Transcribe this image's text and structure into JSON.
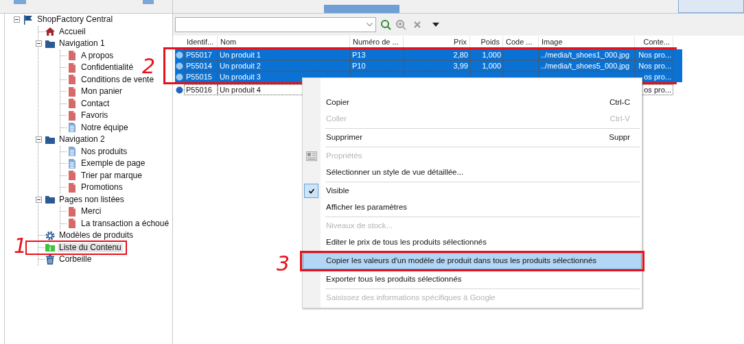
{
  "tree": [
    {
      "label": "ShopFactory Central",
      "kind": "flag",
      "expanded": true,
      "selected": false,
      "children": [
        {
          "label": "Accueil",
          "kind": "house",
          "selected": false
        },
        {
          "label": "Navigation 1",
          "kind": "folder",
          "expanded": true,
          "selected": false,
          "children": [
            {
              "label": "A propos",
              "kind": "page",
              "selected": false
            },
            {
              "label": "Confidentialité",
              "kind": "page",
              "selected": false
            },
            {
              "label": "Conditions de vente",
              "kind": "page",
              "selected": false
            },
            {
              "label": "Mon panier",
              "kind": "page",
              "selected": false
            },
            {
              "label": "Contact",
              "kind": "page",
              "selected": false
            },
            {
              "label": "Favoris",
              "kind": "page",
              "selected": false
            },
            {
              "label": "Notre équipe",
              "kind": "grid-page",
              "selected": false
            }
          ]
        },
        {
          "label": "Navigation 2",
          "kind": "folder",
          "expanded": true,
          "selected": false,
          "children": [
            {
              "label": "Nos produits",
              "kind": "grid-page",
              "selected": false
            },
            {
              "label": "Exemple de page",
              "kind": "grid-page",
              "selected": false
            },
            {
              "label": "Trier par marque",
              "kind": "page",
              "selected": false
            },
            {
              "label": "Promotions",
              "kind": "page",
              "selected": false
            }
          ]
        },
        {
          "label": "Pages non listées",
          "kind": "folder",
          "expanded": true,
          "selected": false,
          "children": [
            {
              "label": "Merci",
              "kind": "page",
              "selected": false
            },
            {
              "label": "La transaction a échoué",
              "kind": "page",
              "selected": false
            }
          ]
        },
        {
          "label": "Modèles de produits",
          "kind": "gear",
          "selected": false
        },
        {
          "label": "Liste du Contenu",
          "kind": "info-folder",
          "selected": true
        },
        {
          "label": "Corbeille",
          "kind": "trash",
          "selected": false
        }
      ]
    }
  ],
  "table": {
    "columns": [
      "Identif...",
      "Nom",
      "Numéro de ...",
      "Prix",
      "Poids",
      "Code ...",
      "Image",
      "Conte..."
    ],
    "rows": [
      {
        "selected": true,
        "id": "P55017",
        "name": "Un produit 1",
        "number": "P13",
        "price": "2,80",
        "weight": "1,000",
        "image": "../media/t_shoes1_000.jpg",
        "content": "Nos pro..."
      },
      {
        "selected": true,
        "id": "P55014",
        "name": "Un produit 2",
        "number": "P10",
        "price": "3,99",
        "weight": "1,000",
        "image": "../media/t_shoes5_000.jpg",
        "content": "Nos pro..."
      },
      {
        "selected": true,
        "id": "P55015",
        "name": "Un produit 3",
        "content": "os pro..."
      },
      {
        "selected": false,
        "id": "P55016",
        "name": "Un produit 4",
        "content": "os pro..."
      }
    ]
  },
  "context_menu": [
    {
      "kind": "item",
      "label": "Copier",
      "shortcut": "Ctrl-C",
      "disabled": false,
      "checked": false,
      "highlighted": false
    },
    {
      "kind": "item",
      "label": "Coller",
      "shortcut": "Ctrl-V",
      "disabled": true,
      "checked": false,
      "highlighted": false
    },
    {
      "kind": "separator"
    },
    {
      "kind": "item",
      "label": "Supprimer",
      "shortcut": "Suppr",
      "disabled": false,
      "checked": false,
      "highlighted": false
    },
    {
      "kind": "separator"
    },
    {
      "kind": "icon-item",
      "label": "Propriétés",
      "disabled": true,
      "checked": false,
      "highlighted": false
    },
    {
      "kind": "item",
      "label": "Sélectionner un style de vue détaillée...",
      "disabled": false,
      "checked": false,
      "highlighted": false
    },
    {
      "kind": "separator"
    },
    {
      "kind": "item",
      "label": "Visible",
      "disabled": false,
      "checked": true,
      "highlighted": false
    },
    {
      "kind": "item",
      "label": "Afficher les paramètres",
      "disabled": false,
      "checked": false,
      "highlighted": false
    },
    {
      "kind": "separator"
    },
    {
      "kind": "item",
      "label": "Niveaux de stock...",
      "disabled": true,
      "checked": false,
      "highlighted": false
    },
    {
      "kind": "item",
      "label": "Editer le prix de tous les produits sélectionnés",
      "disabled": false,
      "checked": false,
      "highlighted": false
    },
    {
      "kind": "item",
      "label": "Copier les valeurs d'un modèle de produit dans tous les produits sélectionnés",
      "disabled": false,
      "checked": false,
      "highlighted": true
    },
    {
      "kind": "item",
      "label": "Exporter tous les produits sélectionnés",
      "disabled": false,
      "checked": false,
      "highlighted": false
    },
    {
      "kind": "separator"
    },
    {
      "kind": "item",
      "label": "Saisissez des informations spécifiques à Google",
      "disabled": true,
      "checked": false,
      "highlighted": false
    }
  ],
  "annotations": [
    {
      "label": "1"
    },
    {
      "label": "2"
    },
    {
      "label": "3"
    }
  ]
}
